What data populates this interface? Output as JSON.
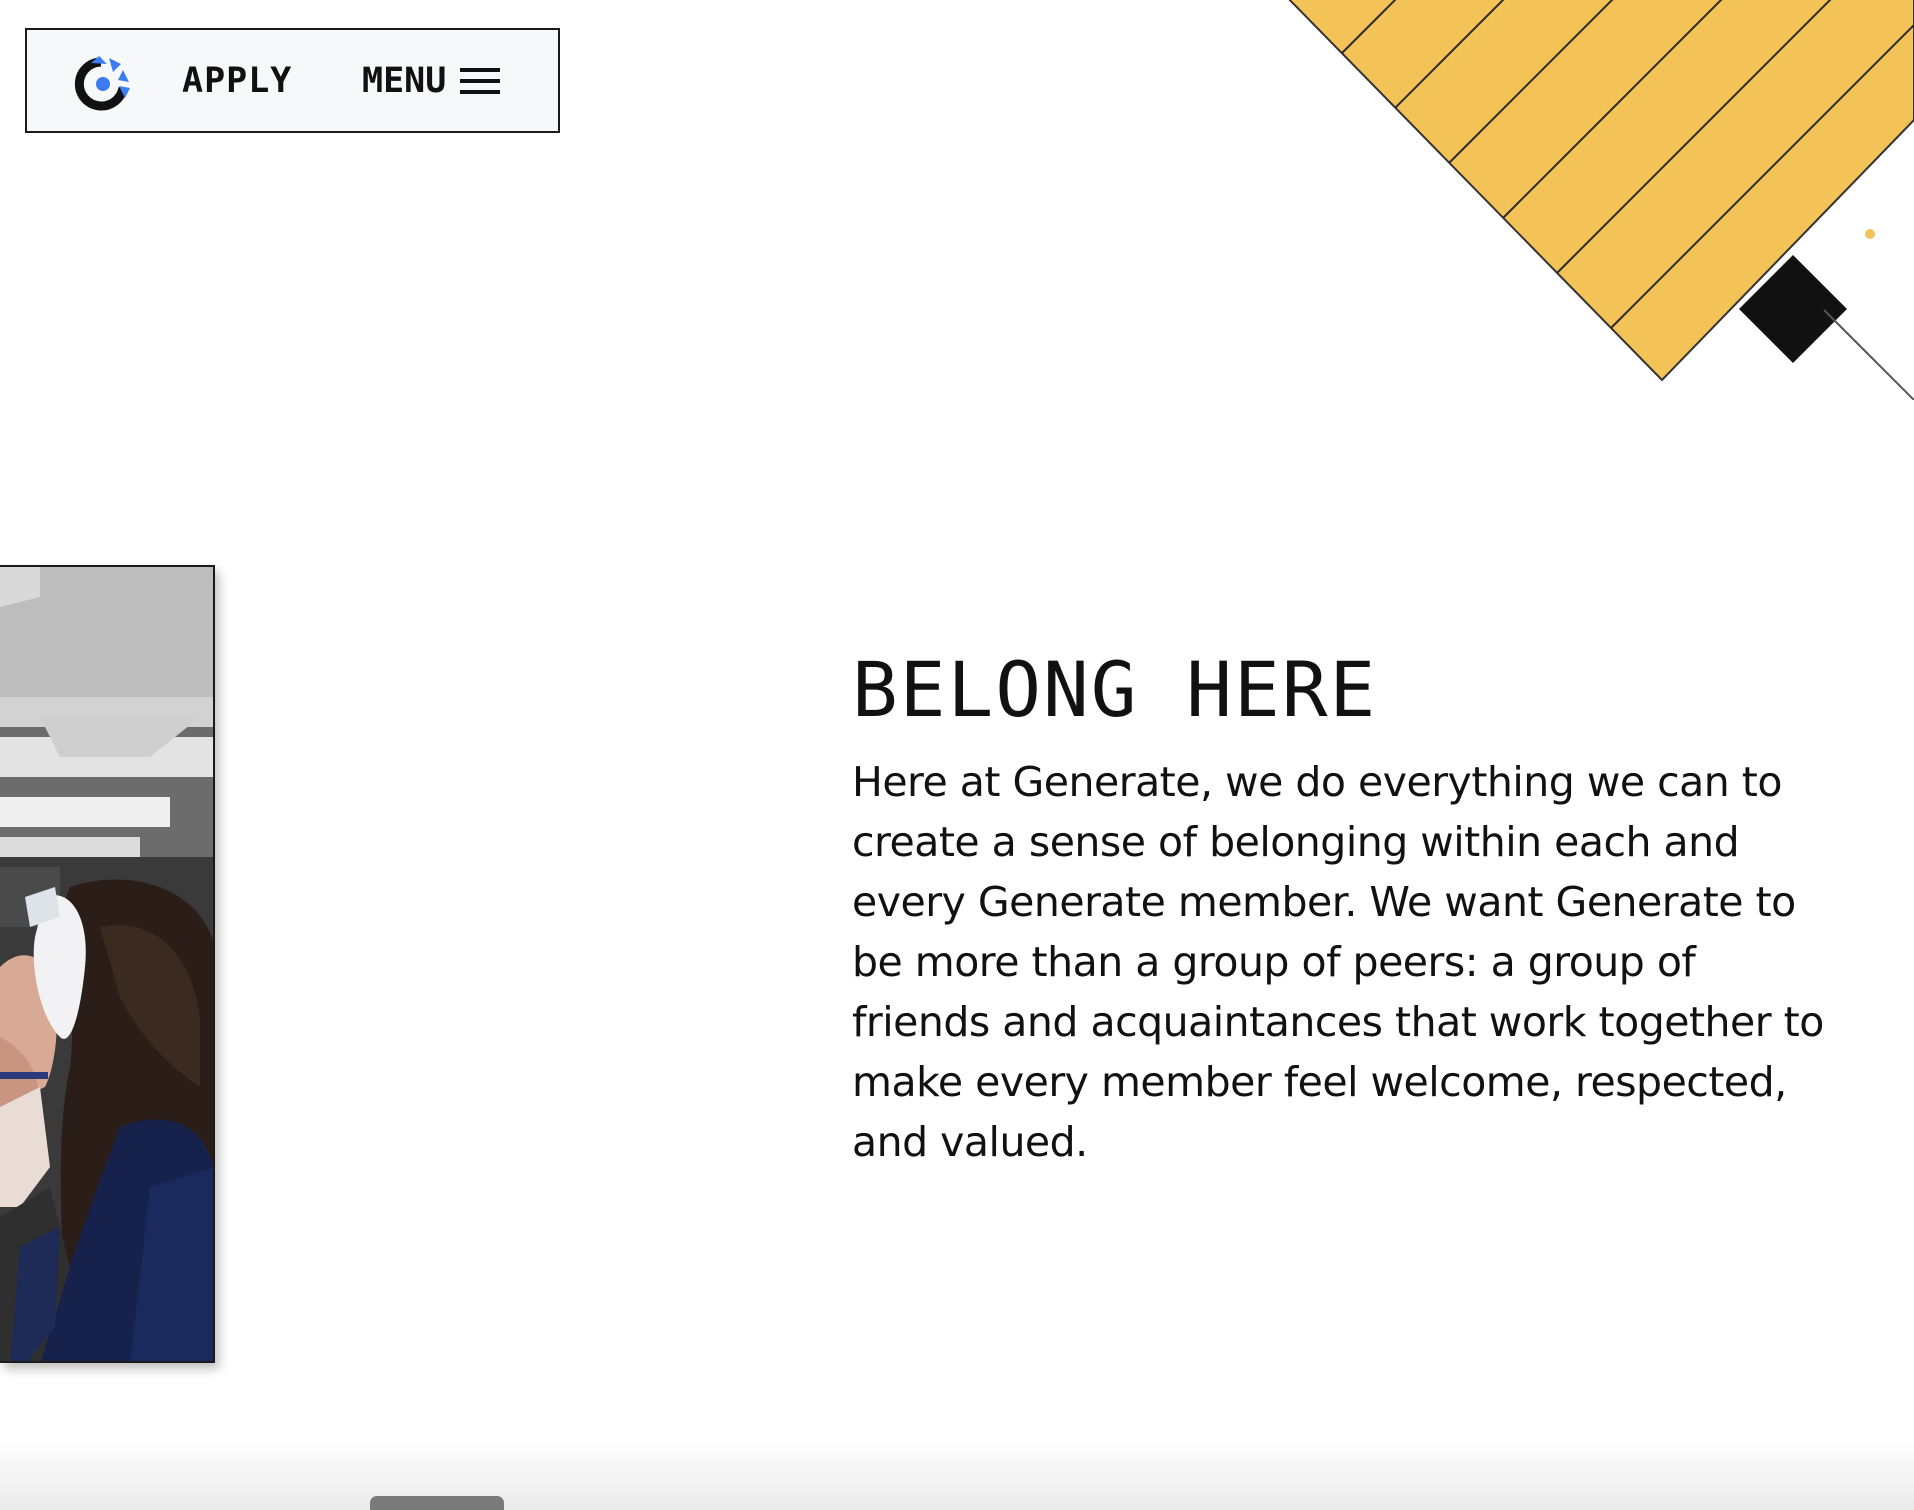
{
  "nav": {
    "apply_label": "APPLY",
    "menu_label": "MENU",
    "logo_icon": "generate-logo-icon",
    "menu_icon": "hamburger-menu-icon"
  },
  "section": {
    "heading": "BELONG HERE",
    "body": "Here at Generate, we do everything we can to create a sense of belonging within each and every Generate member. We want Generate to be more than a group of peers: a group of friends and acquaintances that work together to make every member feel welcome, respected, and valued."
  },
  "colors": {
    "accent_yellow": "#F4C357",
    "logo_blue": "#3B7CF0",
    "ink": "#111111",
    "nav_background": "#F7F8FA"
  }
}
